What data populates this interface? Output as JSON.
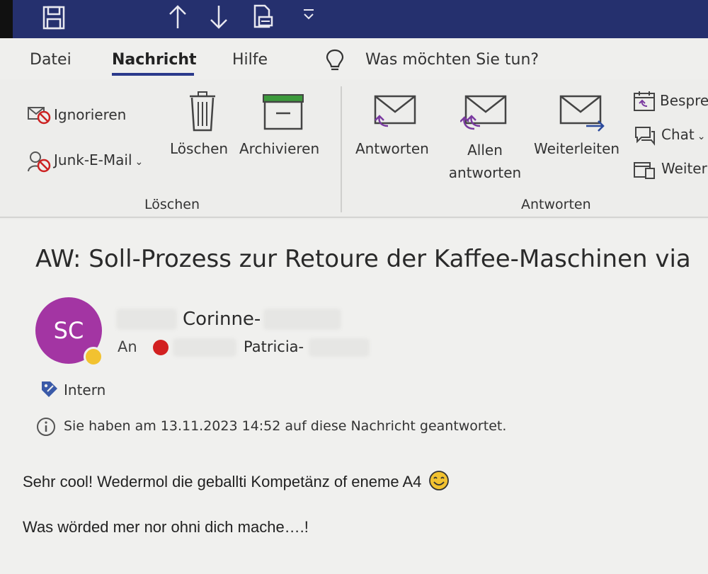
{
  "menu": {
    "tabs": [
      {
        "label": "Datei"
      },
      {
        "label": "Nachricht"
      },
      {
        "label": "Hilfe"
      }
    ],
    "search_prompt": "Was möchten Sie tun?"
  },
  "ribbon": {
    "ignore_label": "Ignorieren",
    "junk_label": "Junk-E-Mail",
    "delete_label": "Löschen",
    "archive_label": "Archivieren",
    "group_delete": "Löschen",
    "reply_label": "Antworten",
    "reply_all_line1": "Allen",
    "reply_all_line2": "antworten",
    "forward_label": "Weiterleiten",
    "group_respond": "Antworten",
    "meeting_label": "Bespre",
    "chat_label": "Chat",
    "more_label": "Weiter"
  },
  "message": {
    "subject": "AW: Soll-Prozess zur Retoure der Kaffee-Maschinen via",
    "avatar_initials": "SC",
    "sender": "Corinne-",
    "to_label": "An",
    "recipient": "Patricia-",
    "classification": "Intern",
    "info": "Sie haben am 13.11.2023 14:52 auf diese Nachricht geantwortet.",
    "body_line1": "Sehr cool! Wedermol die geballti Kompetänz  of eneme A4",
    "body_line2": "Was wörded mer nor ohni dich mache….!"
  },
  "colors": {
    "titlebar": "#25306e",
    "accent": "#2b3a8c",
    "avatar": "#a335a3",
    "presence": "#f2c230",
    "red": "#d22020"
  }
}
